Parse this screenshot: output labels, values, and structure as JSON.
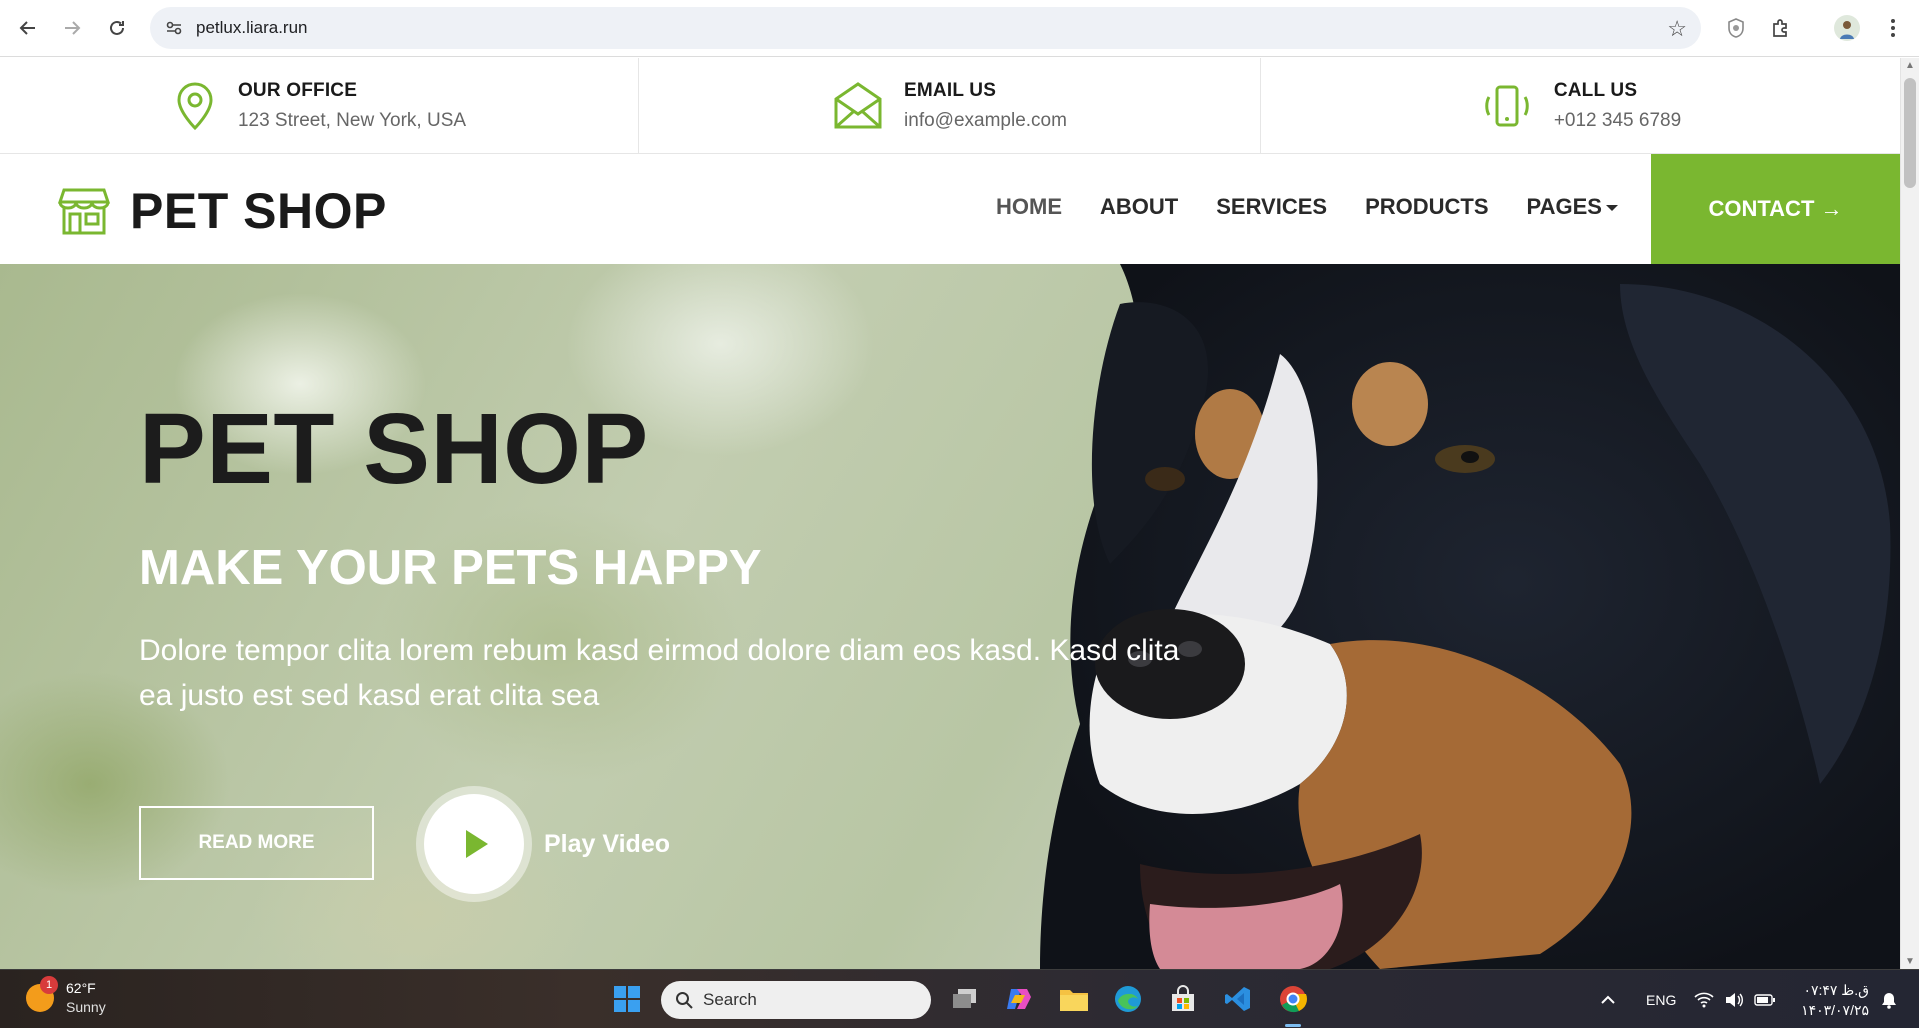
{
  "browser": {
    "url": "petlux.liara.run"
  },
  "contact_info": [
    {
      "title": "OUR OFFICE",
      "value": "123 Street, New York, USA",
      "icon": "map-pin-icon"
    },
    {
      "title": "EMAIL US",
      "value": "info@example.com",
      "icon": "envelope-icon"
    },
    {
      "title": "CALL US",
      "value": "+012 345 6789",
      "icon": "phone-icon"
    }
  ],
  "navbar": {
    "brand": "PET SHOP",
    "links": [
      "HOME",
      "ABOUT",
      "SERVICES",
      "PRODUCTS",
      "PAGES"
    ],
    "active": "HOME",
    "contact_label": "CONTACT",
    "contact_arrow": "→"
  },
  "hero": {
    "title": "PET SHOP",
    "subtitle": "MAKE YOUR PETS HAPPY",
    "text": "Dolore tempor clita lorem rebum kasd eirmod dolore diam eos kasd. Kasd clita ea justo est sed kasd erat clita sea",
    "read_more": "READ MORE",
    "play_label": "Play Video"
  },
  "colors": {
    "accent": "#7ab730",
    "dark": "#1c1c1c"
  },
  "taskbar": {
    "weather_temp": "62°F",
    "weather_desc": "Sunny",
    "weather_badge": "1",
    "search_label": "Search",
    "language": "ENG",
    "time": "۰۷:۴۷ ق.ظ",
    "date": "۱۴۰۳/۰۷/۲۵"
  }
}
